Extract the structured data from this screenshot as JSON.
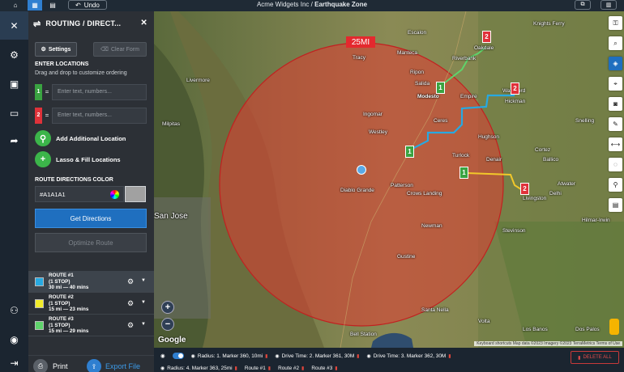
{
  "topbar": {
    "undo_label": "Undo",
    "company": "Acme Widgets Inc /",
    "project": "Earthquake Zone"
  },
  "panel": {
    "title": "ROUTING / DIRECT...",
    "settings_label": "Settings",
    "clear_label": "Clear Form",
    "enter_locations": "ENTER LOCATIONS",
    "drag_hint": "Drag and drop to customize ordering",
    "locations": [
      {
        "num": "1",
        "color": "#3aa341",
        "placeholder": "Enter text, numbers..."
      },
      {
        "num": "2",
        "color": "#e0323a",
        "placeholder": "Enter text, numbers..."
      }
    ],
    "add_location_label": "Add Additional Location",
    "lasso_label": "Lasso & Fill Locations",
    "route_color_label": "ROUTE DIRECTIONS COLOR",
    "route_color_value": "#A1A1A1",
    "get_directions_label": "Get Directions",
    "optimize_label": "Optimize Route",
    "routes": [
      {
        "name": "ROUTE #1",
        "stops": "(1 STOP)",
        "time": "30 mi — 40 mins",
        "color": "#27a9e1"
      },
      {
        "name": "ROUTE #2",
        "stops": "(1 STOP)",
        "time": "15 mi — 23 mins",
        "color": "#f2ec2a"
      },
      {
        "name": "ROUTE #3",
        "stops": "(1 STOP)",
        "time": "15 mi — 29 mins",
        "color": "#5fd36b"
      }
    ],
    "print_label": "Print",
    "export_label": "Export File"
  },
  "map": {
    "radius_label": "25MI",
    "markers": [
      {
        "text": "2",
        "kind": "red"
      },
      {
        "text": "1",
        "kind": "green"
      },
      {
        "text": "2",
        "kind": "red"
      },
      {
        "text": "1",
        "kind": "green"
      },
      {
        "text": "1",
        "kind": "green"
      },
      {
        "text": "2",
        "kind": "red"
      }
    ],
    "places": [
      "Escalon",
      "Riverbank",
      "Oakdale",
      "Knights Ferry",
      "Modesto",
      "Empire",
      "Waterford",
      "Hickman",
      "Ceres",
      "Hughson",
      "Turlock",
      "Denair",
      "Patterson",
      "Crows Landing",
      "Newman",
      "Gustine",
      "San Jose",
      "Milpitas",
      "Livermore",
      "Tracy",
      "Manteca",
      "Ripon",
      "Salida",
      "Westley",
      "Ballico",
      "Cortez",
      "Livingston",
      "Atwater",
      "Delhi",
      "Stevinson",
      "Santa Nella",
      "Los Banos",
      "Ingomar",
      "Volta",
      "Bell Station",
      "Dos Palos",
      "Snelling",
      "Hilmar-Irwin"
    ],
    "big_city": "San Jose",
    "google": "Google",
    "attribution": "Keyboard shortcuts   Map data ©2023 Imagery ©2023 TerraMetrics   Terms of Use"
  },
  "bottom": {
    "row1": [
      "Radius: 1. Marker 360, 10mi",
      "Drive Time: 2. Marker 361, 30M",
      "Drive Time: 3. Marker 362, 30M"
    ],
    "row2": [
      "Radius: 4. Marker 363, 25mi",
      "Route #1",
      "Route #2",
      "Route #3"
    ],
    "delete_all": "DELETE ALL"
  }
}
